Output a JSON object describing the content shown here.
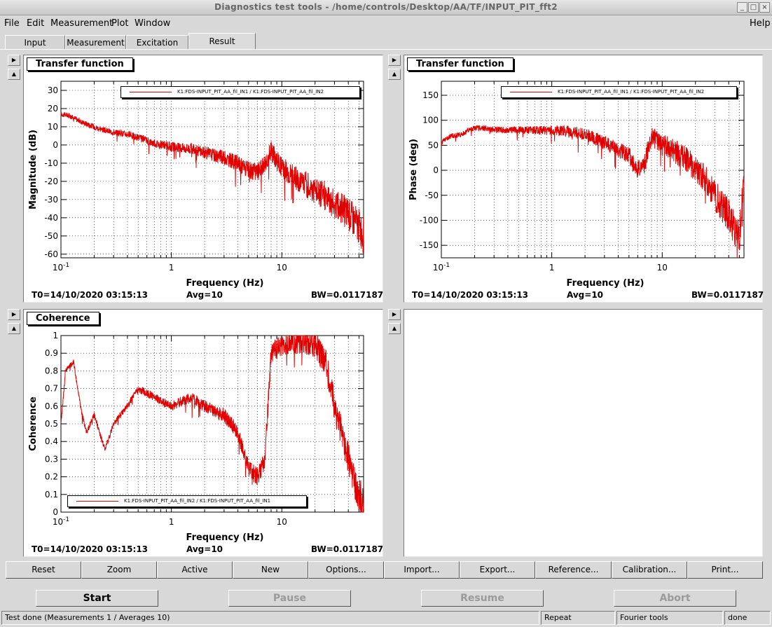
{
  "window": {
    "title": "Diagnostics test tools - /home/controls/Desktop/AA/TF/INPUT_PIT_fft2",
    "controls": [
      "_",
      "□",
      "×"
    ]
  },
  "menu": {
    "file": "File",
    "edit": "Edit",
    "measurement": "Measurement",
    "plot": "Plot",
    "window": "Window",
    "help": "Help"
  },
  "tabs": {
    "input": "Input",
    "measurement": "Measurement",
    "excitation": "Excitation",
    "result": "Result",
    "active": "Result"
  },
  "arrows": {
    "right": "▶",
    "up": "▲"
  },
  "panels": {
    "magnitude": {
      "title": "Transfer function",
      "legend": "K1:FDS-INPUT_PIT_AA_fil_IN1 / K1:FDS-INPUT_PIT_AA_fil_IN2",
      "t0": "T0=14/10/2020 03:15:13",
      "avg": "Avg=10",
      "bw": "BW=0.0117187"
    },
    "phase": {
      "title": "Transfer function",
      "legend": "K1:FDS-INPUT_PIT_AA_fil_IN1 / K1:FDS-INPUT_PIT_AA_fil_IN2",
      "t0": "T0=14/10/2020 03:15:13",
      "avg": "Avg=10",
      "bw": "BW=0.0117187"
    },
    "coherence": {
      "title": "Coherence",
      "legend": "K1:FDS-INPUT_PIT_AA_fil_IN2 / K1:FDS-INPUT_PIT_AA_fil_IN1",
      "t0": "T0=14/10/2020 03:15:13",
      "avg": "Avg=10",
      "bw": "BW=0.0117187"
    }
  },
  "plot_buttons": {
    "reset": "Reset",
    "zoom": "Zoom",
    "active": "Active",
    "new": "New",
    "options": "Options...",
    "import": "Import...",
    "export": "Export...",
    "reference": "Reference...",
    "calibration": "Calibration...",
    "print": "Print..."
  },
  "control_buttons": {
    "start": "Start",
    "pause": "Pause",
    "resume": "Resume",
    "abort": "Abort"
  },
  "status": {
    "message": "Test done (Measurements 1 / Averages 10)",
    "mode": "Repeat",
    "tool": "Fourier tools",
    "state": "done"
  },
  "colors": {
    "trace": "#e00000",
    "background": "#d8d8d8",
    "plot_bg": "#ffffff"
  },
  "chart_data": [
    {
      "type": "line",
      "title": "Transfer function",
      "xlabel": "Frequency (Hz)",
      "ylabel": "Magnitude (dB)",
      "x_scale": "log",
      "xlim": [
        0.1,
        55
      ],
      "ylim": [
        -62,
        35
      ],
      "xticks": [
        "10-1",
        "1",
        "10"
      ],
      "yticks": [
        30,
        20,
        10,
        0,
        -10,
        -20,
        -30,
        -40,
        -50,
        -60
      ],
      "grid": true,
      "legend_position": "top",
      "series": [
        {
          "name": "K1:FDS-INPUT_PIT_AA_fil_IN1 / K1:FDS-INPUT_PIT_AA_fil_IN2",
          "x": [
            0.1,
            0.12,
            0.15,
            0.2,
            0.25,
            0.3,
            0.4,
            0.5,
            0.7,
            1,
            1.5,
            2,
            3,
            4,
            5,
            6,
            7,
            8,
            9,
            10,
            12,
            15,
            20,
            25,
            30,
            40,
            50,
            55
          ],
          "y": [
            17,
            16,
            13,
            10,
            8,
            7,
            6,
            4,
            1,
            -1,
            -2,
            -4,
            -7,
            -10,
            -14,
            -15,
            -10,
            -3,
            -8,
            -12,
            -16,
            -20,
            -25,
            -28,
            -32,
            -38,
            -45,
            -50
          ]
        }
      ]
    },
    {
      "type": "line",
      "title": "Transfer function",
      "xlabel": "Frequency (Hz)",
      "ylabel": "Phase (deg)",
      "x_scale": "log",
      "xlim": [
        0.1,
        55
      ],
      "ylim": [
        -175,
        178
      ],
      "xticks": [
        "10-1",
        "1",
        "10"
      ],
      "yticks": [
        150,
        100,
        50,
        0,
        -50,
        -100,
        -150
      ],
      "grid": true,
      "legend_position": "top",
      "series": [
        {
          "name": "K1:FDS-INPUT_PIT_AA_fil_IN1 / K1:FDS-INPUT_PIT_AA_fil_IN2",
          "x": [
            0.1,
            0.12,
            0.15,
            0.2,
            0.3,
            0.5,
            0.7,
            1,
            1.5,
            2,
            3,
            4,
            5,
            6,
            7,
            8,
            9,
            10,
            12,
            15,
            20,
            25,
            30,
            40,
            50,
            55
          ],
          "y": [
            55,
            68,
            72,
            85,
            82,
            80,
            80,
            80,
            78,
            72,
            55,
            40,
            30,
            0,
            20,
            70,
            58,
            50,
            42,
            30,
            5,
            -20,
            -50,
            -90,
            -140,
            0
          ]
        }
      ]
    },
    {
      "type": "line",
      "title": "Coherence",
      "xlabel": "Frequency (Hz)",
      "ylabel": "Coherence",
      "x_scale": "log",
      "xlim": [
        0.1,
        55
      ],
      "ylim": [
        0,
        1
      ],
      "xticks": [
        "10-1",
        "1",
        "10"
      ],
      "yticks": [
        1,
        0.9,
        0.8,
        0.7,
        0.6,
        0.5,
        0.4,
        0.3,
        0.2,
        0.1,
        0
      ],
      "grid": true,
      "legend_position": "bottom",
      "series": [
        {
          "name": "K1:FDS-INPUT_PIT_AA_fil_IN2 / K1:FDS-INPUT_PIT_AA_fil_IN1",
          "x": [
            0.1,
            0.11,
            0.13,
            0.15,
            0.17,
            0.2,
            0.25,
            0.3,
            0.4,
            0.5,
            0.7,
            1,
            1.5,
            2,
            3,
            4,
            5,
            6,
            7,
            8,
            10,
            15,
            20,
            25,
            30,
            40,
            50,
            55
          ],
          "y": [
            0.5,
            0.8,
            0.85,
            0.6,
            0.45,
            0.55,
            0.35,
            0.5,
            0.6,
            0.7,
            0.65,
            0.6,
            0.65,
            0.6,
            0.55,
            0.45,
            0.25,
            0.2,
            0.3,
            0.9,
            0.95,
            0.97,
            0.95,
            0.85,
            0.6,
            0.3,
            0.1,
            0.05
          ]
        }
      ]
    }
  ]
}
